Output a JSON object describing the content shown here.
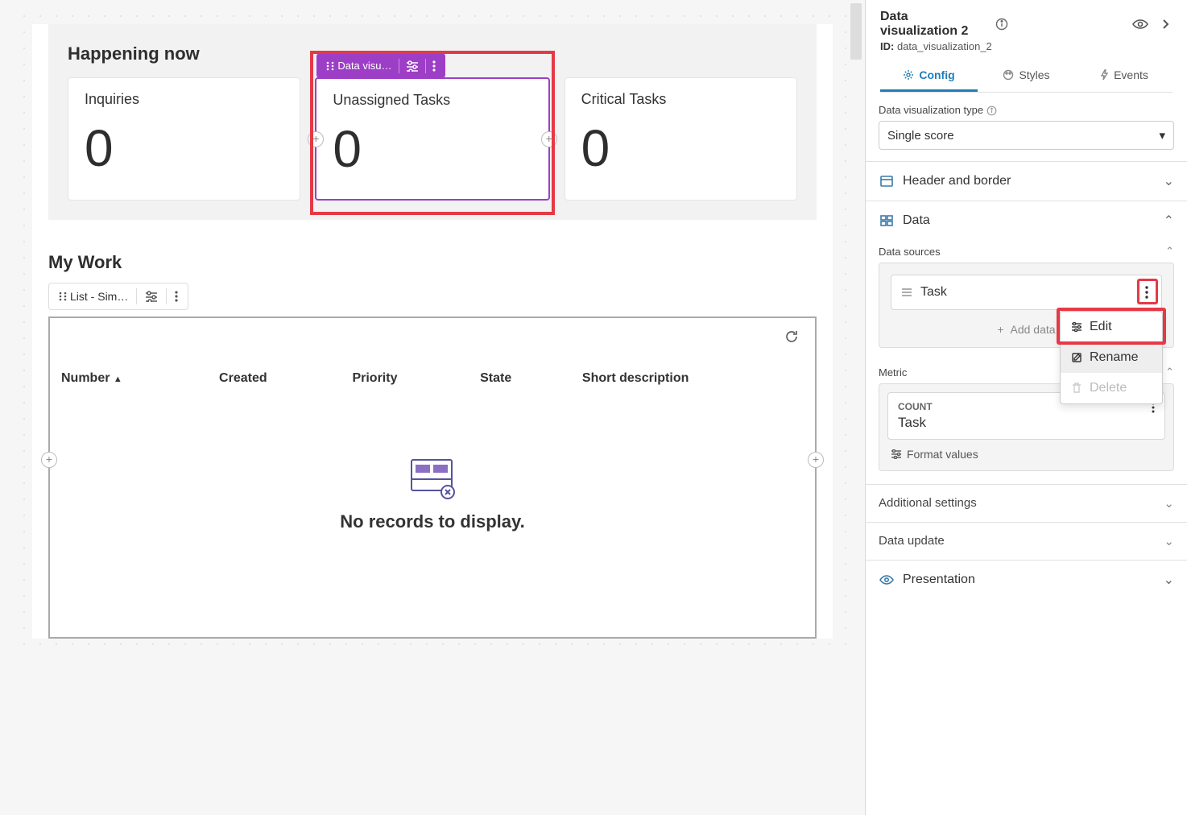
{
  "canvas": {
    "section1_title": "Happening now",
    "cards": [
      {
        "title": "Inquiries",
        "value": "0"
      },
      {
        "title": "Unassigned Tasks",
        "value": "0"
      },
      {
        "title": "Critical Tasks",
        "value": "0"
      }
    ],
    "selected_toolbar_label": "Data visu…",
    "section2_title": "My Work",
    "list_toolbar_label": "List - Sim…",
    "columns": [
      "Number",
      "Created",
      "Priority",
      "State",
      "Short description"
    ],
    "empty_message": "No records to display."
  },
  "right_panel": {
    "title": "Data visualization 2",
    "id_label": "ID:",
    "id_value": "data_visualization_2",
    "tabs": {
      "config": "Config",
      "styles": "Styles",
      "events": "Events"
    },
    "viz_type_label": "Data visualization type",
    "viz_type_value": "Single score",
    "acc_header_border": "Header and border",
    "acc_data": "Data",
    "data_sources_label": "Data sources",
    "data_source_item": "Task",
    "add_data_label": "Add data",
    "context_menu": {
      "edit": "Edit",
      "rename": "Rename",
      "delete": "Delete"
    },
    "metric_label": "Metric",
    "metric_agg": "COUNT",
    "metric_name": "Task",
    "format_values": "Format values",
    "acc_additional": "Additional settings",
    "acc_data_update": "Data update",
    "acc_presentation": "Presentation"
  }
}
